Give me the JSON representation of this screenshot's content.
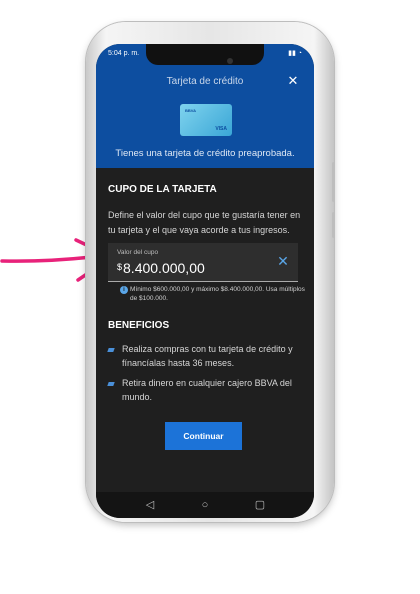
{
  "status": {
    "time": "5:04 p. m.",
    "right": "▮▮ ◔"
  },
  "header": {
    "title": "Tarjeta de crédito",
    "close_icon": "close-icon"
  },
  "card": {
    "brand": "BBVA",
    "network": "VISA"
  },
  "preapproved_text": "Tienes una tarjeta de crédito preaprobada.",
  "cupo": {
    "title": "CUPO DE LA TARJETA",
    "description": "Define el valor del cupo que te gustaría tener en tu tarjeta y el que vaya acorde a tus ingresos.",
    "field_label": "Valor del cupo",
    "currency": "$",
    "field_value": "8.400.000,00",
    "clear_icon": "close-icon",
    "hint": "Mínimo $600.000,00 y máximo $8.400.000,00. Usa múltiplos de $100.000."
  },
  "benefits": {
    "title": "BENEFICIOS",
    "items": [
      "Realiza compras con tu tarjeta de crédito y fínancíalas hasta 36 meses.",
      "Retira dinero en cualquier cajero BBVA del mundo."
    ]
  },
  "continue_label": "Continuar",
  "colors": {
    "brand_blue": "#0d4ea0",
    "button_blue": "#1c73d8",
    "accent_light": "#5aa6e8",
    "arrow_pink": "#e8227a"
  }
}
